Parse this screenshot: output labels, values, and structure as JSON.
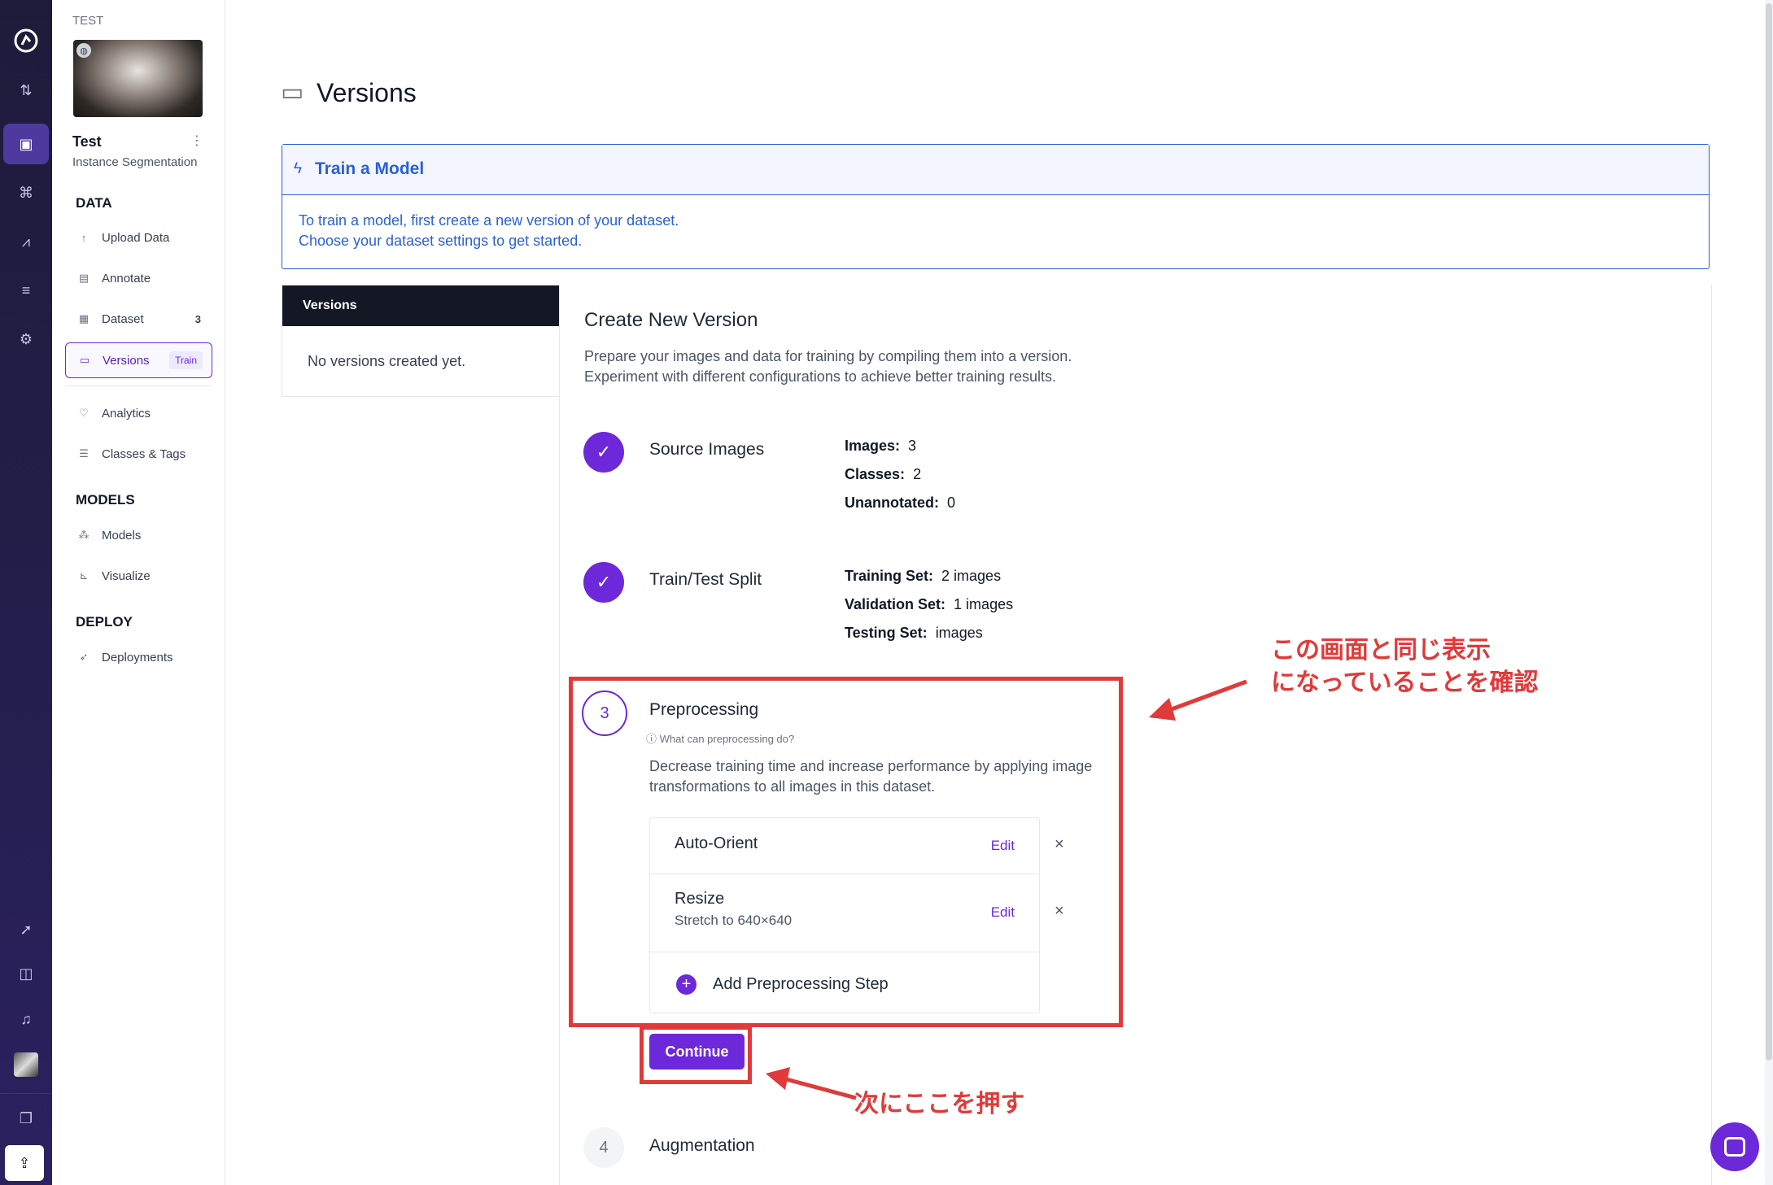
{
  "sidebar": {
    "project_heading": "TEST",
    "project_name": "Test",
    "project_type": "Instance Segmentation",
    "sections": {
      "data": "DATA",
      "models": "MODELS",
      "deploy": "DEPLOY"
    },
    "items": {
      "upload": "Upload Data",
      "annotate": "Annotate",
      "dataset": "Dataset",
      "dataset_count": "3",
      "versions": "Versions",
      "versions_badge": "Train",
      "analytics": "Analytics",
      "classes": "Classes & Tags",
      "models": "Models",
      "visualize": "Visualize",
      "deployments": "Deployments"
    }
  },
  "page": {
    "title": "Versions"
  },
  "banner": {
    "title": "Train a Model",
    "line1": "To train a model, first create a new version of your dataset.",
    "line2": "Choose your dataset settings to get started."
  },
  "versions_panel": {
    "header": "Versions",
    "empty": "No versions created yet."
  },
  "create": {
    "title": "Create New Version",
    "desc1": "Prepare your images and data for training by compiling them into a version.",
    "desc2": "Experiment with different configurations to achieve better training results."
  },
  "source": {
    "title": "Source Images",
    "images_label": "Images:",
    "images": "3",
    "classes_label": "Classes:",
    "classes": "2",
    "unannotated_label": "Unannotated:",
    "unannotated": "0"
  },
  "split": {
    "title": "Train/Test Split",
    "train_label": "Training Set:",
    "train": "2 images",
    "valid_label": "Validation Set:",
    "valid": "1 images",
    "test_label": "Testing Set:",
    "test": "images"
  },
  "preprocessing": {
    "number": "3",
    "title": "Preprocessing",
    "help": "What can preprocessing do?",
    "desc1": "Decrease training time and increase performance by applying image",
    "desc2": "transformations to all images in this dataset.",
    "step1": "Auto-Orient",
    "step2": "Resize",
    "step2_sub": "Stretch to 640×640",
    "edit": "Edit",
    "add": "Add Preprocessing Step",
    "continue": "Continue"
  },
  "augmentation": {
    "number": "4",
    "title": "Augmentation"
  },
  "annotations": {
    "note1_line1": "この画面と同じ表示",
    "note1_line2": "になっていることを確認",
    "note2": "次にここを押す"
  },
  "colors": {
    "accent": "#6d28d9",
    "banner": "#2b5fd9",
    "annotation": "#e03a3a",
    "rail": "#1e1b3a"
  },
  "icons": [
    "roboflow-logo-icon",
    "swap-icon",
    "inbox-icon",
    "workflow-icon",
    "chart-icon",
    "stack-icon",
    "gear-icon",
    "rocket-icon",
    "book-icon",
    "bell-icon",
    "avatar",
    "docs-icon",
    "upload-icon",
    "chat-icon",
    "folder-icon",
    "bolt-icon",
    "check-icon",
    "close-icon",
    "plus-icon",
    "help-icon"
  ]
}
